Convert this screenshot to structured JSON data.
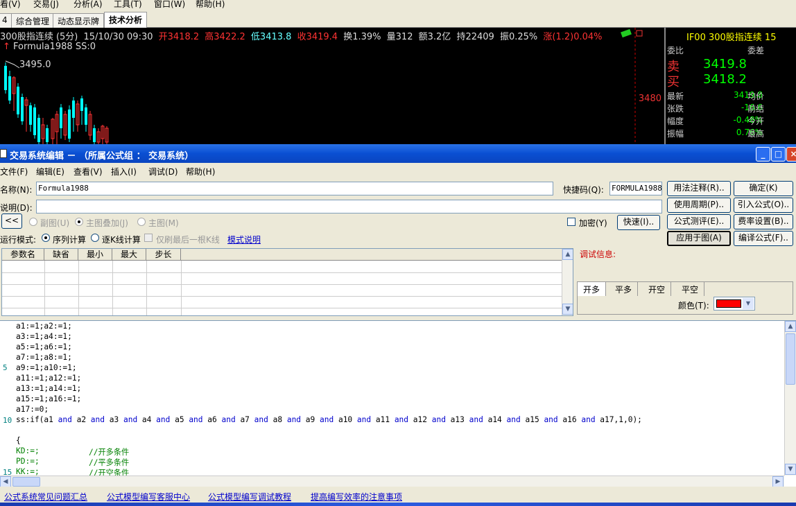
{
  "app": {
    "menu": [
      "看(V)",
      "交易(J)",
      "分析(A)",
      "工具(T)",
      "窗口(W)",
      "帮助(H)"
    ],
    "tabs": [
      "4",
      "综合管理",
      "动态显示牌",
      "技术分析"
    ],
    "quote_line": {
      "symbol": "300股指连续 (5分)",
      "datetime": "15/10/30 09:30",
      "open": "开3418.2",
      "high": "高3422.2",
      "low": "低3413.8",
      "close": "收3419.4",
      "turnover": "换1.39%",
      "volume": "量312",
      "amount": "额3.2亿",
      "position": "持22409",
      "amplitude": "振0.25%",
      "change": "涨(1.2)0.04%"
    },
    "formula_line": "Formula1988 SS:0",
    "high_label": "3495.0",
    "axis_label": "3480",
    "colors": {
      "up": "#ff3333",
      "down": "#00ffff",
      "green": "#00ff00",
      "yellow": "#ffff00"
    },
    "side_panel": {
      "title": "IF00  300股指连续  15",
      "weibi": "委比",
      "weicha": "委差",
      "sell_label": "卖",
      "sell_value": "3419.8",
      "buy_label": "买",
      "buy_value": "3418.2",
      "rows": [
        {
          "label": "最新",
          "value": "3419.8",
          "label2": "均价"
        },
        {
          "label": "张跌",
          "value": "-16.6",
          "label2": "前结"
        },
        {
          "label": "幅度",
          "value": "-0.48%",
          "label2": "今开"
        },
        {
          "label": "振幅",
          "value": "0.76%",
          "label2": "最高"
        }
      ]
    }
  },
  "dialog": {
    "title": "交易系统编辑 － （所属公式组 ： 交易系统）",
    "menu": [
      "文件(F)",
      "编辑(E)",
      "查看(V)",
      "插入(I)",
      "调试(D)",
      "帮助(H)"
    ],
    "name_label": "名称(N):",
    "name_value": "Formula1988",
    "hotkey_label": "快捷码(Q):",
    "hotkey_value": "FORMULA1988",
    "desc_label": "说明(D):",
    "desc_value": "",
    "collapse_button": "<<",
    "chart_mode": {
      "sub": "副图(U)",
      "overlay": "主图叠加(J)",
      "main": "主图(M)"
    },
    "encrypt_label": "加密(Y)",
    "fast_button": "快速(I)..",
    "run_mode_label": "运行模式:",
    "run_mode_seq": "序列计算",
    "run_mode_step": "逐K线计算",
    "refresh_last": "仅刷最后一根K线",
    "mode_help": "模式说明",
    "buttons": {
      "usage": "用法注释(R)..",
      "ok": "确定(K)",
      "period": "使用周期(P)..",
      "import": "引入公式(O)..",
      "test": "公式测评(E)..",
      "fee": "费率设置(B)..",
      "apply": "应用于图(A)",
      "compile": "编译公式(F).."
    },
    "param_headers": [
      "参数名",
      "缺省",
      "最小",
      "最大",
      "步长"
    ],
    "debug_label": "调试信息:",
    "signal_tabs": [
      "开多",
      "平多",
      "开空",
      "平空"
    ],
    "color_label": "颜色(T):",
    "color_value": "#ff0000",
    "code": {
      "gutter": [
        "5",
        "10",
        "15"
      ],
      "lines": [
        "a1:=1;a2:=1;",
        "a3:=1;a4:=1;",
        "a5:=1;a6:=1;",
        "a7:=1;a8:=1;",
        "a9:=1;a10:=1;",
        "a11:=1;a12:=1;",
        "a13:=1;a14:=1;",
        "a15:=1;a16:=1;",
        "a17:=0;",
        "{",
        "KD:=;",
        "PD:=;",
        "KK:=;"
      ],
      "ss_line": {
        "prefix": "ss:if(a1",
        "conj": "and",
        "terms": [
          "a2",
          "a3",
          "a4",
          "a5",
          "a6",
          "a7",
          "a8",
          "a9",
          "a10",
          "a11",
          "a12",
          "a13",
          "a14",
          "a15",
          "a16"
        ],
        "suffix": "a17,1,0);"
      },
      "comments": [
        "//开多条件",
        "//平多条件",
        "//开空条件"
      ]
    },
    "footer_links": [
      "公式系统常见问题汇总",
      "公式模型编写客服中心",
      "公式模型编写调试教程",
      "提高编写效率的注意事项"
    ]
  }
}
